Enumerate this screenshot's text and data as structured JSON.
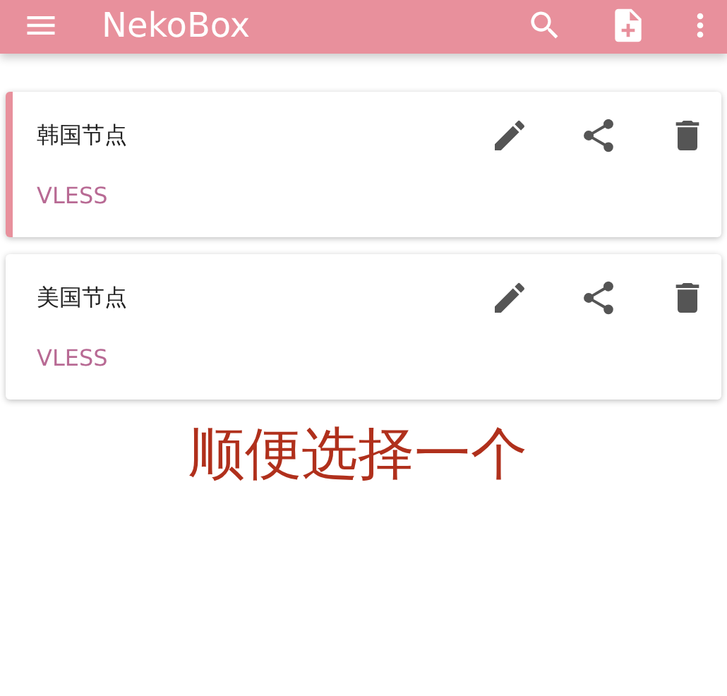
{
  "app_bar": {
    "title": "NekoBox"
  },
  "profiles": [
    {
      "name": "韩国节点",
      "type": "VLESS",
      "selected": true
    },
    {
      "name": "美国节点",
      "type": "VLESS",
      "selected": false
    }
  ],
  "annotation": "顺便选择一个"
}
